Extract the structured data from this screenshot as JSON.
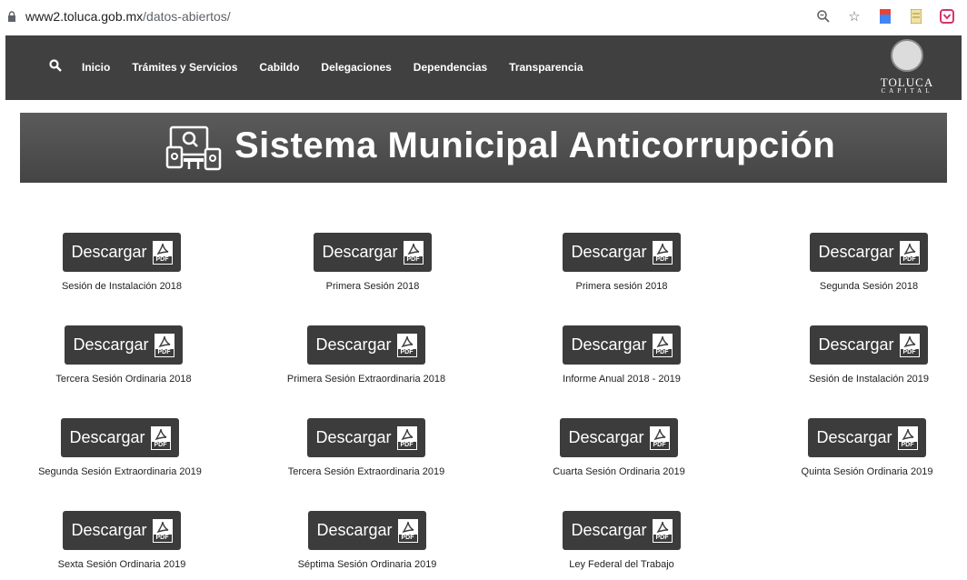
{
  "browser": {
    "url_host": "www2.toluca.gob.mx",
    "url_path": "/datos-abiertos/",
    "icons": [
      "zoom-icon",
      "star-icon",
      "extension-icon-1",
      "extension-icon-2",
      "extension-icon-3"
    ]
  },
  "nav": {
    "items": [
      "Inicio",
      "Trámites y Servicios",
      "Cabildo",
      "Delegaciones",
      "Dependencias",
      "Transparencia"
    ],
    "logo_name": "TOLUCA",
    "logo_sub": "CAPITAL"
  },
  "banner": {
    "title": "Sistema Municipal Anticorrupción"
  },
  "download_label": "Descargar",
  "pdf_tag": "PDF",
  "documents": [
    "Sesión de Instalación 2018",
    "Primera Sesión 2018",
    "Primera sesión 2018",
    "Segunda Sesión 2018",
    "Tercera Sesión Ordinaria 2018",
    "Primera Sesión Extraordinaria 2018",
    "Informe Anual 2018 - 2019",
    "Sesión de Instalación 2019",
    "Segunda Sesión Extraordinaria 2019",
    "Tercera Sesión Extraordinaria 2019",
    "Cuarta Sesión Ordinaria 2019",
    "Quinta Sesión Ordinaria 2019",
    "Sexta Sesión Ordinaria 2019",
    "Séptima Sesión Ordinaria 2019",
    "Ley Federal del Trabajo"
  ]
}
